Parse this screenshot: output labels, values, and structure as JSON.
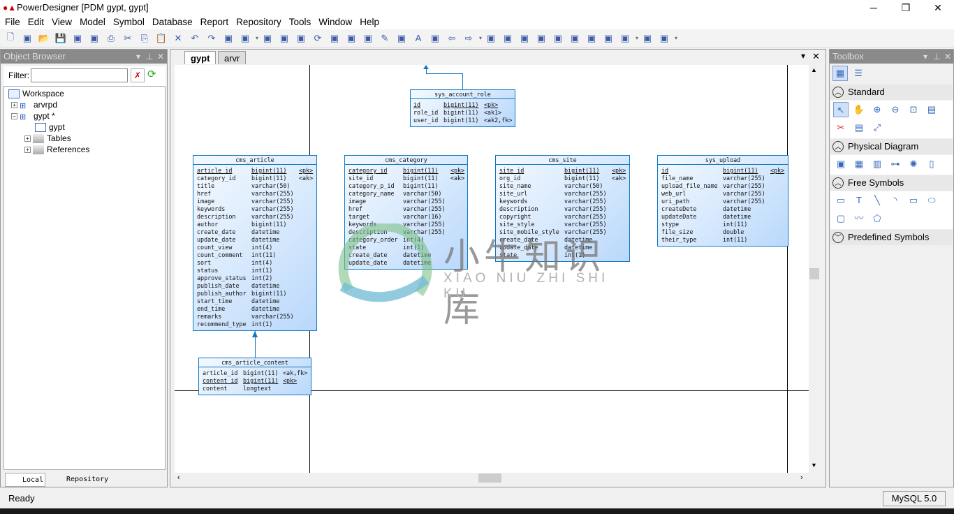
{
  "window": {
    "title": "PowerDesigner [PDM gypt, gypt]",
    "controls": [
      "minimize",
      "restore",
      "close"
    ]
  },
  "menu": [
    "File",
    "Edit",
    "View",
    "Model",
    "Symbol",
    "Database",
    "Report",
    "Repository",
    "Tools",
    "Window",
    "Help"
  ],
  "toolbar": [
    "new-icon",
    "new-project-icon",
    "open-icon",
    "save-icon",
    "save-all-icon",
    "print-preview-icon",
    "print-icon",
    "cut-icon",
    "copy-icon",
    "paste-icon",
    "delete-icon",
    "undo-icon",
    "redo-icon",
    "properties-icon",
    "check-model-icon",
    "sep",
    "model-icon",
    "package-icon",
    "browse-icon",
    "refresh-icon",
    "check-icon",
    "rectangle-icon",
    "group-icon",
    "pen-icon",
    "fill-icon",
    "font-icon",
    "align-icon",
    "back-icon",
    "forward-icon",
    "sep",
    "diagram-icon",
    "diagram2-icon",
    "diagram3-icon",
    "diagram4-icon",
    "diagram5-icon",
    "diagram6-icon",
    "zoom-select-icon",
    "comment-icon",
    "list-icon",
    "sep",
    "preview-icon",
    "print2-icon",
    "sep"
  ],
  "object_browser": {
    "title": "Object Browser",
    "filter_label": "Filter:",
    "filter_value": "",
    "tree": [
      "Workspace",
      "arvrpd",
      "gypt *",
      "gypt",
      "Tables",
      "References"
    ],
    "tabs": [
      "Local",
      "Repository"
    ]
  },
  "document": {
    "tabs": [
      "gypt",
      "arvr"
    ],
    "active_tab": "gypt"
  },
  "tables": [
    {
      "name": "sys_account_role",
      "columns": [
        {
          "name": "id",
          "type": "bigint(11)",
          "key": "<pk>",
          "pk": true
        },
        {
          "name": "role_id",
          "type": "bigint(11)",
          "key": "<ak1>"
        },
        {
          "name": "user_id",
          "type": "bigint(11)",
          "key": "<ak2,fk>"
        }
      ]
    },
    {
      "name": "cms_article",
      "columns": [
        {
          "name": "article_id",
          "type": "bigint(11)",
          "key": "<pk>",
          "pk": true
        },
        {
          "name": "category_id",
          "type": "bigint(11)",
          "key": "<ak>"
        },
        {
          "name": "title",
          "type": "varchar(50)",
          "key": ""
        },
        {
          "name": "href",
          "type": "varchar(255)",
          "key": ""
        },
        {
          "name": "image",
          "type": "varchar(255)",
          "key": ""
        },
        {
          "name": "keywords",
          "type": "varchar(255)",
          "key": ""
        },
        {
          "name": "description",
          "type": "varchar(255)",
          "key": ""
        },
        {
          "name": "author",
          "type": "bigint(11)",
          "key": ""
        },
        {
          "name": "create_date",
          "type": "datetime",
          "key": ""
        },
        {
          "name": "update_date",
          "type": "datetime",
          "key": ""
        },
        {
          "name": "count_view",
          "type": "int(4)",
          "key": ""
        },
        {
          "name": "count_comment",
          "type": "int(11)",
          "key": ""
        },
        {
          "name": "sort",
          "type": "int(4)",
          "key": ""
        },
        {
          "name": "status",
          "type": "int(1)",
          "key": ""
        },
        {
          "name": "approve_status",
          "type": "int(2)",
          "key": ""
        },
        {
          "name": "publish_date",
          "type": "datetime",
          "key": ""
        },
        {
          "name": "publish_author",
          "type": "bigint(11)",
          "key": ""
        },
        {
          "name": "start_time",
          "type": "datetime",
          "key": ""
        },
        {
          "name": "end_time",
          "type": "datetime",
          "key": ""
        },
        {
          "name": "remarks",
          "type": "varchar(255)",
          "key": ""
        },
        {
          "name": "recommend_type",
          "type": "int(1)",
          "key": ""
        }
      ]
    },
    {
      "name": "cms_category",
      "columns": [
        {
          "name": "category_id",
          "type": "bigint(11)",
          "key": "<pk>",
          "pk": true
        },
        {
          "name": "site_id",
          "type": "bigint(11)",
          "key": "<ak>"
        },
        {
          "name": "category_p_id",
          "type": "bigint(11)",
          "key": ""
        },
        {
          "name": "category_name",
          "type": "varchar(50)",
          "key": ""
        },
        {
          "name": "image",
          "type": "varchar(255)",
          "key": ""
        },
        {
          "name": "href",
          "type": "varchar(255)",
          "key": ""
        },
        {
          "name": "target",
          "type": "varchar(16)",
          "key": ""
        },
        {
          "name": "keywords",
          "type": "varchar(255)",
          "key": ""
        },
        {
          "name": "description",
          "type": "varchar(255)",
          "key": ""
        },
        {
          "name": "category_order",
          "type": "int(4)",
          "key": ""
        },
        {
          "name": "state",
          "type": "int(1)",
          "key": ""
        },
        {
          "name": "create_date",
          "type": "datetime",
          "key": ""
        },
        {
          "name": "update_date",
          "type": "datetime",
          "key": ""
        }
      ]
    },
    {
      "name": "cms_site",
      "columns": [
        {
          "name": "site_id",
          "type": "bigint(11)",
          "key": "<pk>",
          "pk": true
        },
        {
          "name": "org_id",
          "type": "bigint(11)",
          "key": "<ak>"
        },
        {
          "name": "site_name",
          "type": "varchar(50)",
          "key": ""
        },
        {
          "name": "site_url",
          "type": "varchar(255)",
          "key": ""
        },
        {
          "name": "keywords",
          "type": "varchar(255)",
          "key": ""
        },
        {
          "name": "description",
          "type": "varchar(255)",
          "key": ""
        },
        {
          "name": "copyright",
          "type": "varchar(255)",
          "key": ""
        },
        {
          "name": "site_style",
          "type": "varchar(255)",
          "key": ""
        },
        {
          "name": "site_mobile_style",
          "type": "varchar(255)",
          "key": ""
        },
        {
          "name": "create_date",
          "type": "datetime",
          "key": ""
        },
        {
          "name": "update_date",
          "type": "datetime",
          "key": ""
        },
        {
          "name": "state",
          "type": "int(1)",
          "key": ""
        }
      ]
    },
    {
      "name": "sys_upload",
      "columns": [
        {
          "name": "id",
          "type": "bigint(11)",
          "key": "<pk>",
          "pk": true
        },
        {
          "name": "file_name",
          "type": "varchar(255)",
          "key": ""
        },
        {
          "name": "upload_file_name",
          "type": "varchar(255)",
          "key": ""
        },
        {
          "name": "web_url",
          "type": "varchar(255)",
          "key": ""
        },
        {
          "name": "uri_path",
          "type": "varchar(255)",
          "key": ""
        },
        {
          "name": "createDete",
          "type": "datetime",
          "key": ""
        },
        {
          "name": "updateDate",
          "type": "datetime",
          "key": ""
        },
        {
          "name": "stype",
          "type": "int(11)",
          "key": ""
        },
        {
          "name": "file_size",
          "type": "double",
          "key": ""
        },
        {
          "name": "their_type",
          "type": "int(11)",
          "key": ""
        }
      ]
    },
    {
      "name": "cms_article_content",
      "columns": [
        {
          "name": "article_id",
          "type": "bigint(11)",
          "key": "<ak,fk>"
        },
        {
          "name": "content_id",
          "type": "bigint(11)",
          "key": "<pk>",
          "pk": true
        },
        {
          "name": "content",
          "type": "longtext",
          "key": ""
        }
      ]
    }
  ],
  "watermark": {
    "cn": "小牛知识库",
    "en": "XIAO NIU ZHI SHI KU"
  },
  "toolbox": {
    "title": "Toolbox",
    "sections": [
      {
        "label": "Standard",
        "expanded": true,
        "icons": [
          "pointer-icon",
          "hand-icon",
          "zoom-in-icon",
          "zoom-out-icon",
          "zoom-fit-icon",
          "properties-icon",
          "cut-icon",
          "note-icon",
          "link-icon"
        ]
      },
      {
        "label": "Physical Diagram",
        "expanded": true,
        "icons": [
          "package-icon",
          "table-icon",
          "view-icon",
          "reference-icon",
          "procedure-icon",
          "file-icon"
        ]
      },
      {
        "label": "Free Symbols",
        "expanded": true,
        "icons": [
          "title-icon",
          "text-icon",
          "line-icon",
          "arc-icon",
          "rectangle-icon",
          "ellipse-icon",
          "rounded-rect-icon",
          "polyline-icon",
          "polygon-icon"
        ]
      },
      {
        "label": "Predefined Symbols",
        "expanded": false,
        "icons": []
      }
    ]
  },
  "status": {
    "left": "Ready",
    "dbms": "MySQL 5.0"
  }
}
